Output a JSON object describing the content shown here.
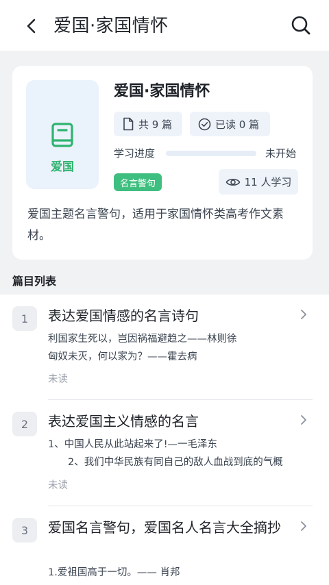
{
  "header": {
    "title": "爱国·家国情怀",
    "back_icon": "back-arrow-icon",
    "search_icon": "search-icon"
  },
  "info": {
    "cover_label": "爱国",
    "cover_icon": "book-icon",
    "title": "爱国·家国情怀",
    "total_label": "共 9 篇",
    "read_label": "已读 0 篇",
    "progress_label": "学习进度",
    "progress_value": 0,
    "progress_status": "未开始",
    "tag": "名言警句",
    "learners": "11 人学习",
    "description": "爱国主题名言警句，适用于家国情怀类高考作文素材。"
  },
  "section_label": "篇目列表",
  "items": [
    {
      "number": "1",
      "title": "表达爱国情感的名言诗句",
      "excerpt_1": "利国家生死以，岂因祸福避趋之——林则徐",
      "excerpt_2": "匈奴未灭，何以家为？——霍去病",
      "status": "未读"
    },
    {
      "number": "2",
      "title": "表达爱国主义情感的名言",
      "excerpt_1": "1、中国人民从此站起来了!—一毛泽东",
      "excerpt_2": "　　2、我们中华民族有同自己的敌人血战到底的气概",
      "status": "未读"
    },
    {
      "number": "3",
      "title": "爱国名言警句，爱国名人名言大全摘抄",
      "excerpt_1": "1.爱祖国高于一切。—— 肖邦",
      "excerpt_2": "",
      "status": ""
    }
  ],
  "colors": {
    "accent": "#2fb36f",
    "chip_bg": "#eef3fa",
    "cover_bg": "#eaf2fb"
  }
}
